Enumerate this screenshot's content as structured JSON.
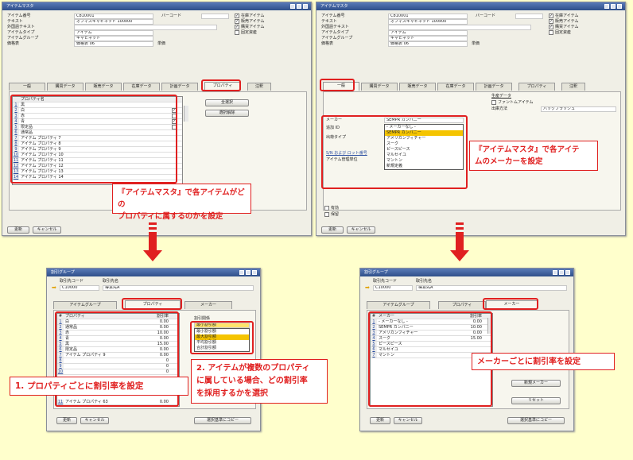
{
  "top_left": {
    "title": "アイテムマスタ",
    "fields": [
      {
        "label": "アイテム番号",
        "value": "C810001"
      },
      {
        "label": "テキスト",
        "value": "オフィスキャビネット 100x00"
      },
      {
        "label": "外国語テキスト",
        "value": ""
      },
      {
        "label": "アイテムタイプ",
        "value": "アイテム"
      },
      {
        "label": "アイテムグループ",
        "value": "キャビネット"
      },
      {
        "label": "価格表",
        "value": "価格表 06"
      }
    ],
    "barcode_label": "バーコード",
    "unit_label": "単価",
    "checks": [
      "在庫アイテム",
      "販売アイテム",
      "購買アイテム",
      "固定資産"
    ],
    "tabs": [
      "一般",
      "購買データ",
      "販売データ",
      "在庫データ",
      "計画データ",
      "プロパティ",
      "注釈"
    ],
    "grid_header": "プロパティ名",
    "grid_rows": [
      "黒",
      "白",
      "赤",
      "青",
      "限定品",
      "通常品",
      "アイテム プロパティ 7",
      "アイテム プロパティ 8",
      "アイテム プロパティ 9",
      "アイテム プロパティ 10",
      "アイテム プロパティ 11",
      "アイテム プロパティ 12",
      "アイテム プロパティ 13",
      "アイテム プロパティ 14"
    ],
    "btn_select_all": "全選択",
    "btn_clear": "選択解除",
    "btn_update": "更新",
    "btn_cancel": "キャンセル"
  },
  "top_right": {
    "title": "アイテムマスタ",
    "fields": [
      {
        "label": "アイテム番号",
        "value": "C810001"
      },
      {
        "label": "テキスト",
        "value": "オフィスキャビネット 100x00"
      },
      {
        "label": "外国語テキスト",
        "value": ""
      },
      {
        "label": "アイテムタイプ",
        "value": "アイテム"
      },
      {
        "label": "アイテムグループ",
        "value": "キャビネット"
      },
      {
        "label": "価格表",
        "value": "価格表 06"
      }
    ],
    "barcode_label": "バーコード",
    "unit_label": "単価",
    "checks": [
      "在庫アイテム",
      "販売アイテム",
      "購買アイテム",
      "固定資産"
    ],
    "tabs": [
      "一般",
      "購買データ",
      "販売データ",
      "在庫データ",
      "計画データ",
      "プロパティ",
      "注釈"
    ],
    "gen_labels": [
      "メーカー",
      "追加 ID",
      "出荷タイプ",
      "",
      "S/N および ロット番号",
      "アイテム管理単位"
    ],
    "maker_value": "SEMPR カンパニー",
    "production_data": "生産データ",
    "phantom": "ファントムアイテム",
    "issue_method_label": "出庫方法",
    "issue_method_value": "バックフラッシュ",
    "dropdown": [
      "- メーカーなし -",
      "SEMPR カンパニー",
      "アメリカンフィチャー",
      "スーク",
      "ピースピース",
      "マルセイユ",
      "マントン",
      "新規定義"
    ],
    "active_label": "有効",
    "inactive_label": "保留",
    "btn_update": "更新",
    "btn_cancel": "キャンセル"
  },
  "bottom_left": {
    "title": "割引グループ",
    "bp_code_label": "取引先コード",
    "bp_name_label": "取引先名",
    "bp_code": "C10000",
    "bp_name": "得意先A",
    "tabs": [
      "アイテムグループ",
      "プロパティ",
      "メーカー"
    ],
    "col_num": "#",
    "col_prop": "プロパティ",
    "col_rate": "割引率",
    "rows": [
      {
        "n": "1",
        "name": "白",
        "rate": "0.00"
      },
      {
        "n": "2",
        "name": "通常品",
        "rate": "0.00"
      },
      {
        "n": "3",
        "name": "赤",
        "rate": "10.00"
      },
      {
        "n": "4",
        "name": "青",
        "rate": "0.00"
      },
      {
        "n": "5",
        "name": "黒",
        "rate": "15.00"
      },
      {
        "n": "6",
        "name": "限定品",
        "rate": "0.00"
      },
      {
        "n": "7",
        "name": "アイテム プロパティ 9",
        "rate": "0.00"
      },
      {
        "n": "8",
        "name": "",
        "rate": "0"
      },
      {
        "n": "9",
        "name": "",
        "rate": "0"
      },
      {
        "n": "10",
        "name": "",
        "rate": "0"
      },
      {
        "n": "11",
        "name": "アイテム プロパティ 63",
        "rate": "0.00"
      }
    ],
    "relation_label": "割引関係",
    "relation_value": "最小割引額",
    "relation_options": [
      "最小割引額",
      "最大割引額",
      "平均割引額",
      "合計割引額"
    ],
    "btn_update": "更新",
    "btn_cancel": "キャンセル",
    "btn_copy": "選択基準にコピー"
  },
  "bottom_right": {
    "title": "割引グループ",
    "bp_code_label": "取引先コード",
    "bp_name_label": "取引先名",
    "bp_code": "C10000",
    "bp_name": "得意先A",
    "tabs": [
      "アイテムグループ",
      "プロパティ",
      "メーカー"
    ],
    "col_num": "#",
    "col_maker": "メーカー",
    "col_rate": "割引率",
    "rows": [
      {
        "n": "1",
        "name": "- メーカーなし -",
        "rate": "0.00"
      },
      {
        "n": "2",
        "name": "SEMPR カンパニー",
        "rate": "10.00"
      },
      {
        "n": "3",
        "name": "アメリカンフィチャー",
        "rate": "0.00"
      },
      {
        "n": "4",
        "name": "スーク",
        "rate": "15.00"
      },
      {
        "n": "5",
        "name": "ピースピース",
        "rate": ""
      },
      {
        "n": "6",
        "name": "マルセイユ",
        "rate": ""
      },
      {
        "n": "7",
        "name": "マントン",
        "rate": ""
      }
    ],
    "btn_new_maker": "新規メーカー",
    "btn_reset": "リセット",
    "btn_update": "更新",
    "btn_cancel": "キャンセル",
    "btn_copy": "選択基準にコピー"
  },
  "notes": {
    "n1": "『アイテムマスタ』で各アイテムがどの\nプロパティに属するのかを設定",
    "n2": "『アイテムマスタ』で各アイテ\nムのメーカーを設定",
    "n3": "1. プロパティごとに割引率を設定",
    "n4": "2. アイテムが複数のプロパティ\nに属している場合、どの割引率\nを採用するかを選択",
    "n5": "メーカーごとに割引率を設定"
  },
  "colors": {
    "accent": "#e02020",
    "background": "#ffffcc",
    "titlebar": "#3d5f9e",
    "highlight": "#f5c400"
  }
}
